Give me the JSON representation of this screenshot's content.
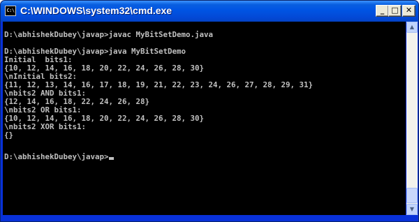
{
  "window": {
    "title": "C:\\WINDOWS\\system32\\cmd.exe",
    "app_icon_text": "C:\\",
    "controls": {
      "minimize": "_",
      "maximize": "□",
      "close": "✕"
    }
  },
  "console": {
    "lines": [
      "",
      "D:\\abhishekDubey\\javap>javac MyBitSetDemo.java",
      "",
      "D:\\abhishekDubey\\javap>java MyBitSetDemo",
      "Initial  bits1:",
      "{10, 12, 14, 16, 18, 20, 22, 24, 26, 28, 30}",
      "\\nInitial bits2:",
      "{11, 12, 13, 14, 16, 17, 18, 19, 21, 22, 23, 24, 26, 27, 28, 29, 31}",
      "\\nbits2 AND bits1:",
      "{12, 14, 16, 18, 22, 24, 26, 28}",
      "\\nbits2 OR bits1:",
      "{10, 12, 14, 16, 18, 20, 22, 24, 26, 28, 30}",
      "\\nbits2 XOR bits1:",
      "{}",
      "",
      "D:\\abhishekDubey\\javap>"
    ]
  },
  "scrollbar": {
    "up_arrow": "▲",
    "down_arrow": "▼"
  }
}
